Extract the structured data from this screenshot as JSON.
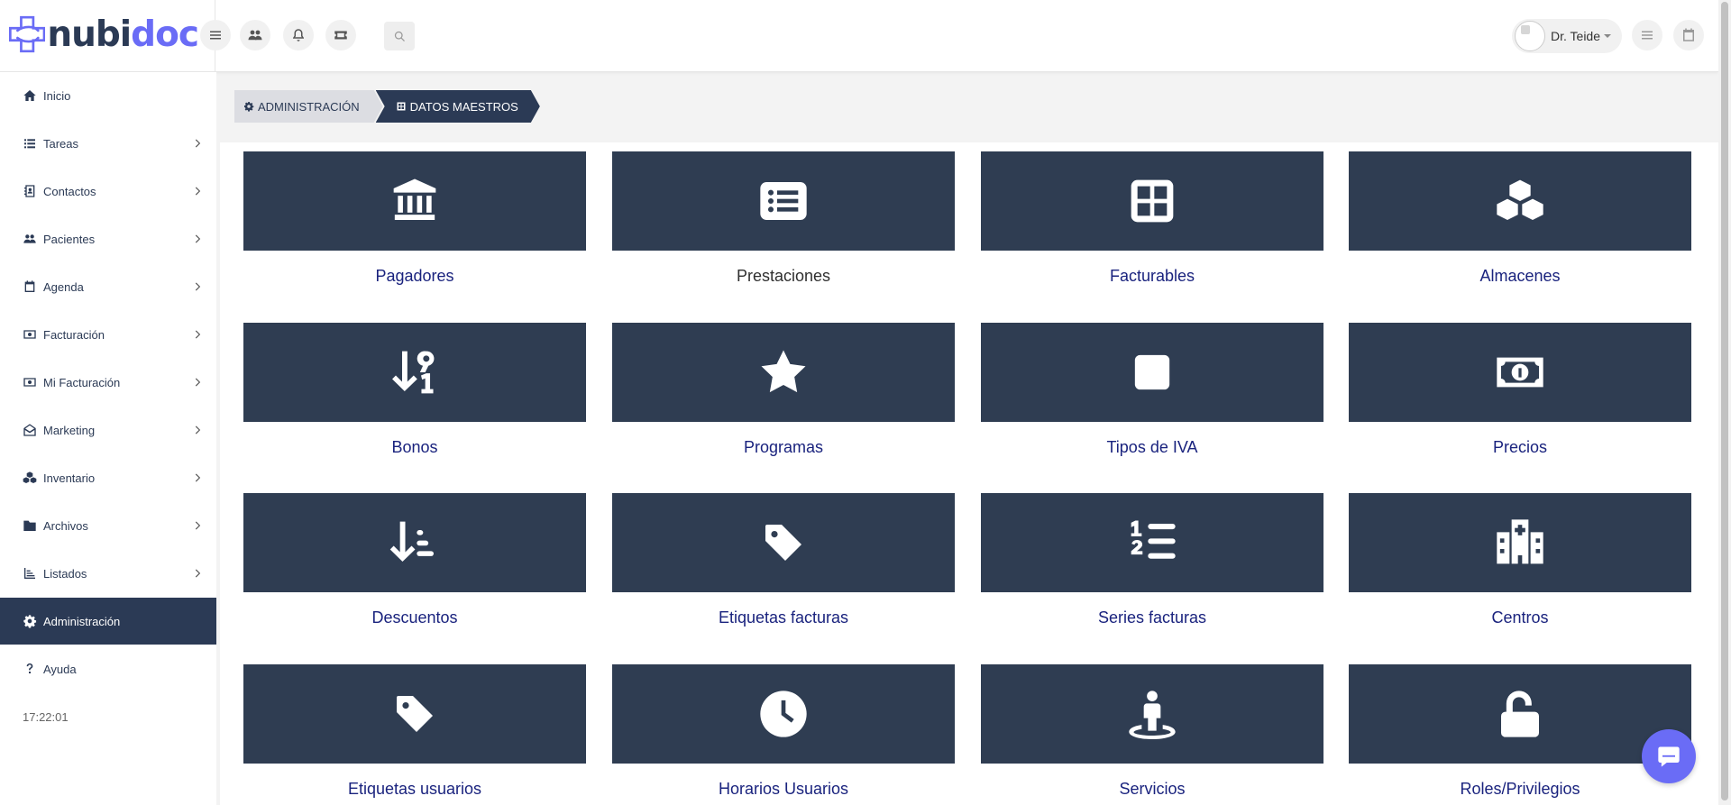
{
  "brand": {
    "part1": "nubi",
    "part2": "doc",
    "mark_color": "#6a6cf6",
    "text_color": "#2b3a55"
  },
  "topbar": {
    "icons": [
      "menu-icon",
      "users-icon",
      "bell-icon",
      "ticket-icon"
    ],
    "search_icon": "search-icon",
    "user_name": "Dr. Teide",
    "right_icons": [
      "list-icon",
      "calendar-icon"
    ]
  },
  "sidebar": {
    "items": [
      {
        "label": "Inicio",
        "icon": "home-icon",
        "has_chevron": false
      },
      {
        "label": "Tareas",
        "icon": "list-icon",
        "has_chevron": true
      },
      {
        "label": "Contactos",
        "icon": "address-book-icon",
        "has_chevron": true
      },
      {
        "label": "Pacientes",
        "icon": "users-icon",
        "has_chevron": true
      },
      {
        "label": "Agenda",
        "icon": "calendar-icon",
        "has_chevron": true
      },
      {
        "label": "Facturación",
        "icon": "money-icon",
        "has_chevron": true
      },
      {
        "label": "Mi Facturación",
        "icon": "money-icon",
        "has_chevron": true
      },
      {
        "label": "Marketing",
        "icon": "envelope-icon",
        "has_chevron": true
      },
      {
        "label": "Inventario",
        "icon": "cubes-icon",
        "has_chevron": true
      },
      {
        "label": "Archivos",
        "icon": "folder-icon",
        "has_chevron": true
      },
      {
        "label": "Listados",
        "icon": "chart-icon",
        "has_chevron": true
      },
      {
        "label": "Administración",
        "icon": "gear-icon",
        "has_chevron": false,
        "active": true
      },
      {
        "label": "Ayuda",
        "icon": "question-icon",
        "has_chevron": false
      }
    ],
    "time": "17:22:01",
    "active_color": "#2b3a55"
  },
  "breadcrumb": {
    "items": [
      {
        "label": "ADMINISTRACIÓN",
        "icon": "gear-icon"
      },
      {
        "label": "DATOS MAESTROS",
        "icon": "grid-icon"
      }
    ]
  },
  "cards": [
    {
      "label": "Pagadores",
      "icon": "bank-icon"
    },
    {
      "label": "Prestaciones",
      "icon": "list-alt-icon",
      "dark": true
    },
    {
      "label": "Facturables",
      "icon": "grid-icon"
    },
    {
      "label": "Almacenes",
      "icon": "cubes-icon"
    },
    {
      "label": "Bonos",
      "icon": "sort-numeric-icon"
    },
    {
      "label": "Programas",
      "icon": "star-icon"
    },
    {
      "label": "Tipos de IVA",
      "icon": "square-icon"
    },
    {
      "label": "Precios",
      "icon": "money-bill-icon"
    },
    {
      "label": "Descuentos",
      "icon": "sort-amount-down-icon"
    },
    {
      "label": "Etiquetas facturas",
      "icon": "tag-icon"
    },
    {
      "label": "Series facturas",
      "icon": "list-ol-icon"
    },
    {
      "label": "Centros",
      "icon": "hospital-icon"
    },
    {
      "label": "Etiquetas usuarios",
      "icon": "tag-icon"
    },
    {
      "label": "Horarios Usuarios",
      "icon": "clock-icon"
    },
    {
      "label": "Servicios",
      "icon": "street-view-icon"
    },
    {
      "label": "Roles/Privilegios",
      "icon": "unlock-icon"
    }
  ],
  "colors": {
    "card_bg": "#2f3d52",
    "card_label": "#1a237e",
    "chat_button": "#6a6cf6"
  },
  "chat": {
    "icon": "chat-icon"
  }
}
